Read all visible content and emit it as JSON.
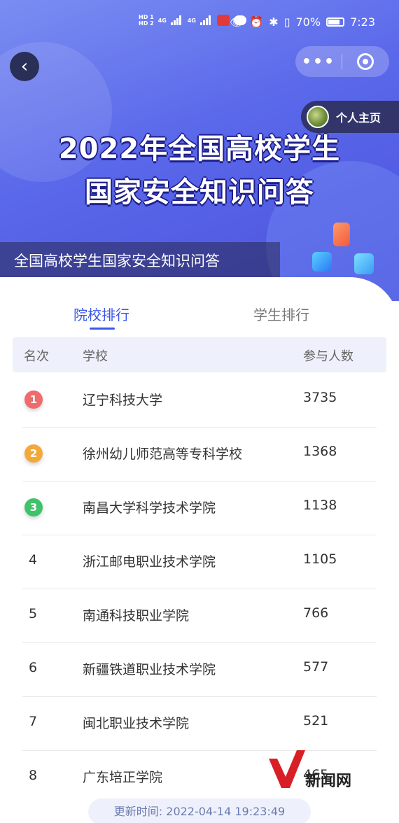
{
  "status_bar": {
    "hd1": "HD 1",
    "hd2": "HD 2",
    "net1": "4G",
    "net2": "4G",
    "battery": "70%",
    "time": "7:23"
  },
  "nav": {
    "back_icon": "chevron-left-icon",
    "more_icon": "more-dots-icon",
    "close_icon": "target-icon"
  },
  "banner": {
    "title_line1": "2022年全国高校学生",
    "title_line2": "国家安全知识问答",
    "subtitle": "全国高校学生国家安全知识问答",
    "profile_label": "个人主页"
  },
  "tabs": [
    {
      "label": "院校排行",
      "active": true
    },
    {
      "label": "学生排行",
      "active": false
    }
  ],
  "table": {
    "headers": [
      "名次",
      "学校",
      "参与人数"
    ],
    "rows": [
      {
        "rank": "1",
        "school": "辽宁科技大学",
        "count": "3735"
      },
      {
        "rank": "2",
        "school": "徐州幼儿师范高等专科学校",
        "count": "1368"
      },
      {
        "rank": "3",
        "school": "南昌大学科学技术学院",
        "count": "1138"
      },
      {
        "rank": "4",
        "school": "浙江邮电职业技术学院",
        "count": "1105"
      },
      {
        "rank": "5",
        "school": "南通科技职业学院",
        "count": "766"
      },
      {
        "rank": "6",
        "school": "新疆铁道职业技术学院",
        "count": "577"
      },
      {
        "rank": "7",
        "school": "闽北职业技术学院",
        "count": "521"
      },
      {
        "rank": "8",
        "school": "广东培正学院",
        "count": "465"
      }
    ]
  },
  "update_time": "更新时间:  2022-04-14 19:23:49",
  "watermark": {
    "text": "新闻网"
  },
  "colors": {
    "accent": "#3c57e8",
    "gold": "#f06b6b",
    "silver": "#f3a93a",
    "bronze": "#3fc26a"
  }
}
